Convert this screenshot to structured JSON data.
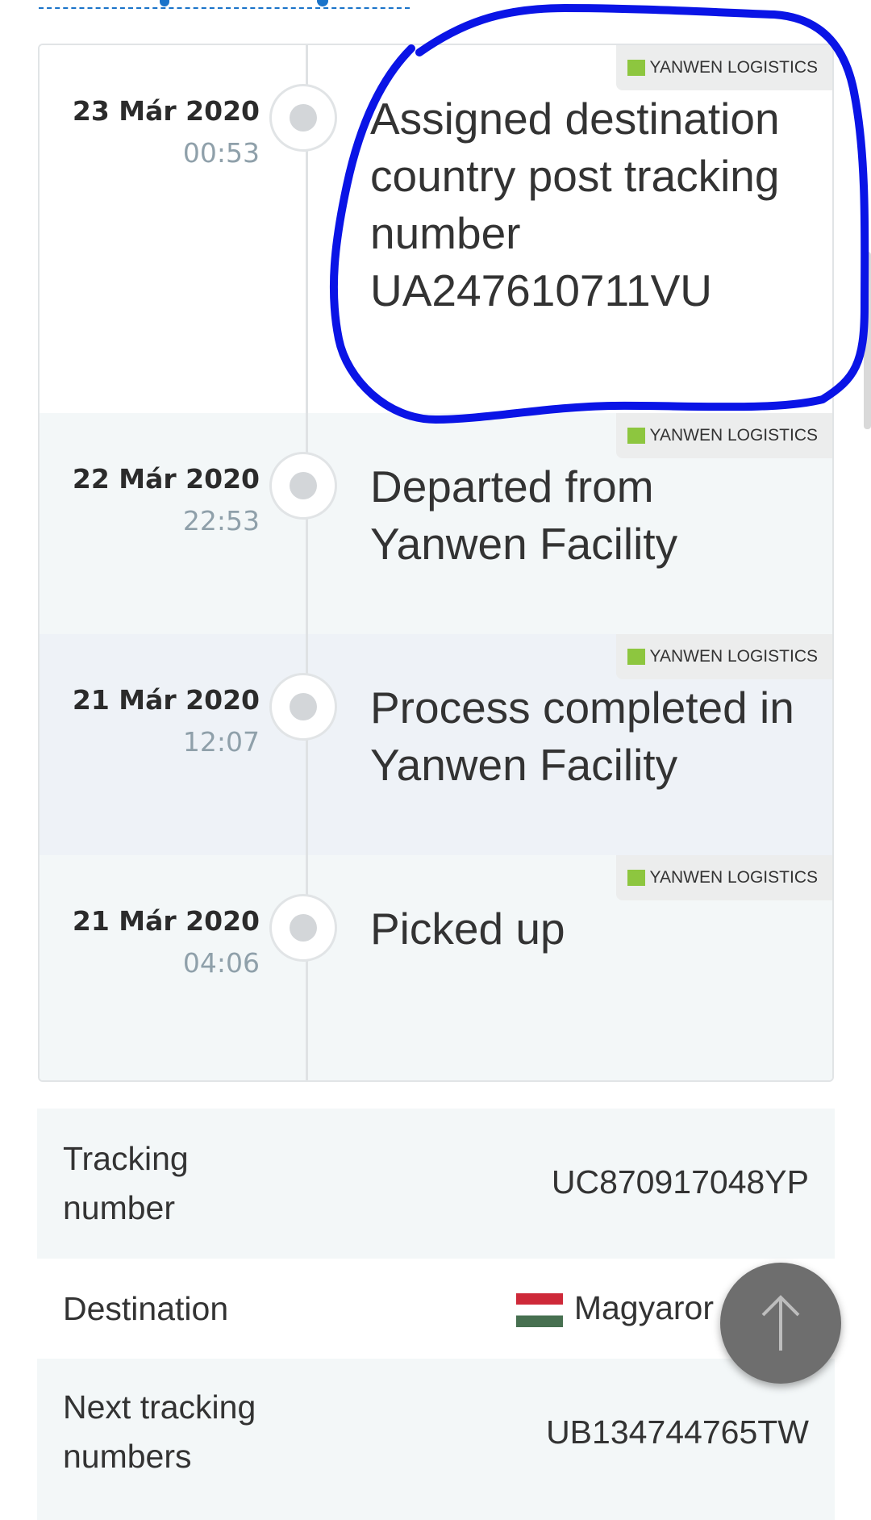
{
  "events": [
    {
      "date": "23 Már 2020",
      "time": "00:53",
      "carrier": "YANWEN LOGISTICS",
      "description": "Assigned destination country post tracking number UA247610711VU"
    },
    {
      "date": "22 Már 2020",
      "time": "22:53",
      "carrier": "YANWEN LOGISTICS",
      "description": "Departed from Yanwen Facility"
    },
    {
      "date": "21 Már 2020",
      "time": "12:07",
      "carrier": "YANWEN LOGISTICS",
      "description": "Process completed in Yanwen Facility"
    },
    {
      "date": "21 Már 2020",
      "time": "04:06",
      "carrier": "YANWEN LOGISTICS",
      "description": "Picked up"
    }
  ],
  "info": {
    "tracking_label": "Tracking number",
    "tracking_value": "UC870917048YP",
    "destination_label": "Destination",
    "destination_value": "Magyaror",
    "next_label": "Next tracking numbers",
    "next_value": "UB134744765TW"
  },
  "colors": {
    "annotation": "#0a14e6",
    "event_bg_alt": "#f3f7f8",
    "event_bg_alt2": "#eef2f7",
    "carrier_logo": "#8dc63f"
  },
  "icons": {
    "scroll_top": "arrow-up-icon",
    "flag": "hungary-flag-icon",
    "carrier_logo": "yanwen-logo-icon"
  }
}
